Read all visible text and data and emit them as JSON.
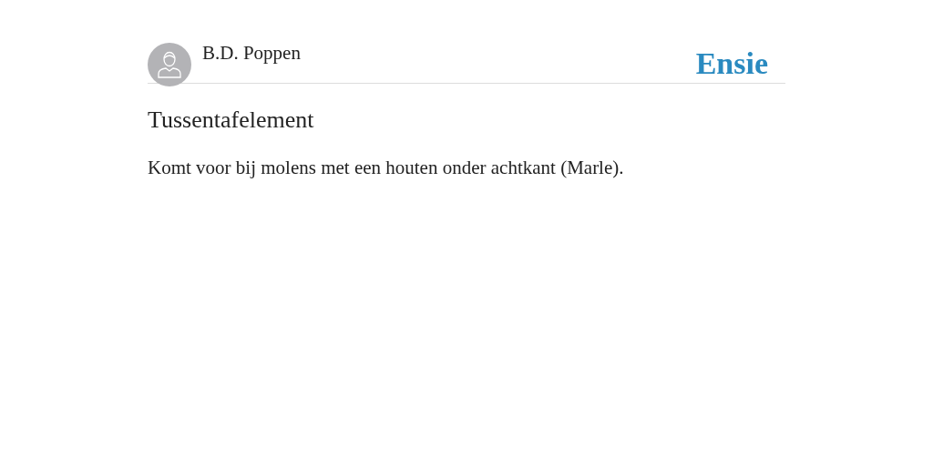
{
  "author": {
    "name": "B.D. Poppen"
  },
  "logo": {
    "text": "Ensie"
  },
  "entry": {
    "title": "Tussentafelement",
    "body": "Komt voor bij molens met een houten onder achtkant (Marle)."
  }
}
